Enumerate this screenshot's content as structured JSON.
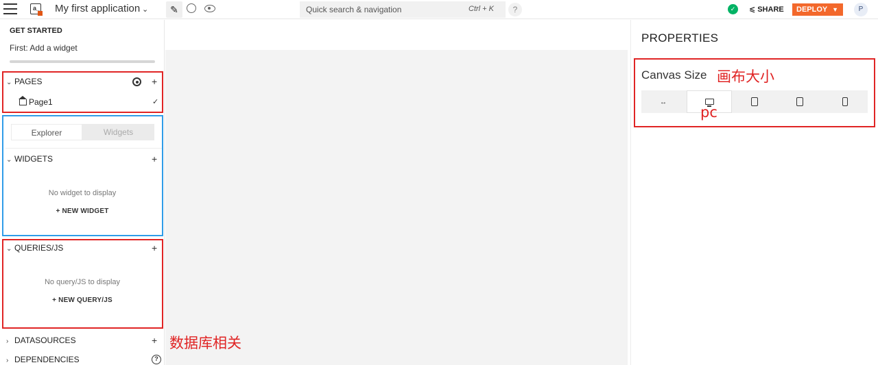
{
  "app": {
    "title": "My first application"
  },
  "toolbar": {
    "search_placeholder": "Quick search & navigation",
    "search_shortcut": "Ctrl + K",
    "help": "?",
    "share_label": "SHARE",
    "deploy_label": "DEPLOY",
    "avatar_initial": "P"
  },
  "sidebar": {
    "get_started": {
      "title": "GET STARTED",
      "subtitle": "First: Add a widget",
      "progress": 0
    },
    "pages": {
      "title": "PAGES",
      "items": [
        {
          "label": "Page1"
        }
      ]
    },
    "tabs": [
      {
        "label": "Explorer",
        "active": true
      },
      {
        "label": "Widgets",
        "active": false
      }
    ],
    "widgets": {
      "title": "WIDGETS",
      "empty": "No widget to display",
      "new_label": "+ NEW WIDGET"
    },
    "queries": {
      "title": "QUERIES/JS",
      "empty": "No query/JS to display",
      "new_label": "+ NEW QUERY/JS"
    },
    "datasources": {
      "title": "DATASOURCES"
    },
    "dependencies": {
      "title": "DEPENDENCIES"
    }
  },
  "properties": {
    "title": "PROPERTIES",
    "canvas_size_label": "Canvas Size",
    "canvas_size_options": [
      "fluid",
      "desktop",
      "tablet-landscape",
      "tablet",
      "mobile"
    ],
    "selected_option": "desktop"
  },
  "annotations": {
    "canvas_size": "画布大小",
    "pc": "pc",
    "database": "数据库相关"
  },
  "colors": {
    "accent": "#f3682b",
    "success": "#03b365",
    "annotation_red": "#e02424",
    "annotation_blue": "#2f9ce8"
  }
}
